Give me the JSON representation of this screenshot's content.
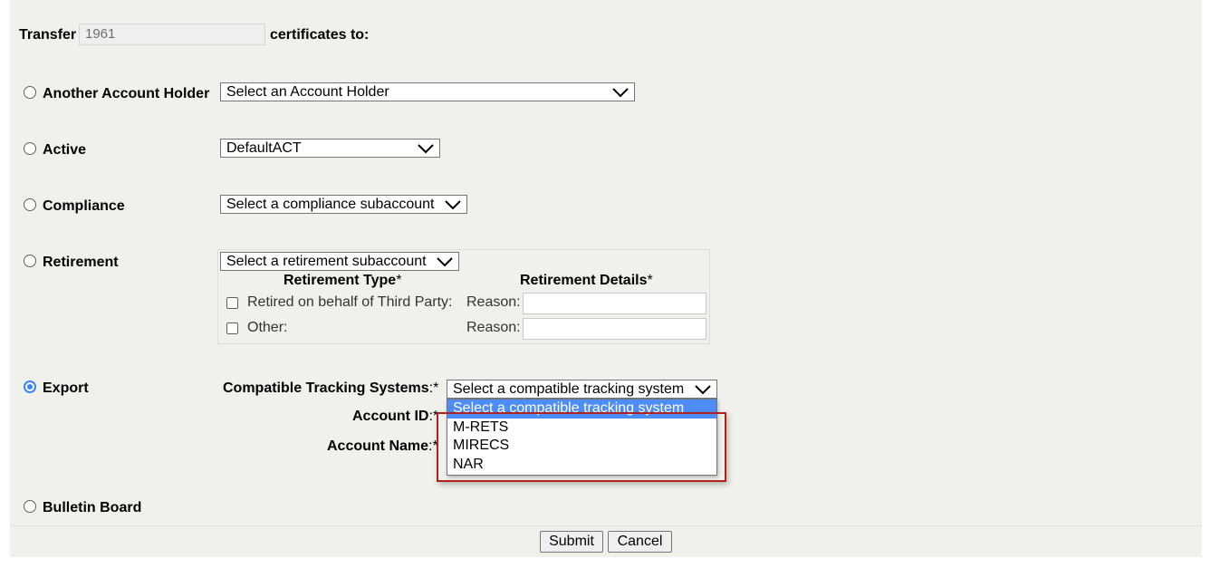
{
  "transfer": {
    "label": "Transfer",
    "quantity_value": "1961",
    "suffix": "certificates to:"
  },
  "destinations": {
    "another_account_holder": {
      "label": "Another Account Holder",
      "select_value": "Select an Account Holder",
      "checked": false
    },
    "active": {
      "label": "Active",
      "select_value": "DefaultACT",
      "checked": false
    },
    "compliance": {
      "label": "Compliance",
      "select_value": "Select a compliance subaccount",
      "checked": false
    },
    "retirement": {
      "label": "Retirement",
      "select_value": "Select a retirement subaccount",
      "checked": false,
      "type_header": "Retirement Type",
      "details_header": "Retirement Details",
      "required_mark": "*",
      "rows": [
        {
          "label": "Retired on behalf of Third Party:",
          "reason_label": "Reason:",
          "reason_value": ""
        },
        {
          "label": "Other:",
          "reason_label": "Reason:",
          "reason_value": ""
        }
      ]
    },
    "export": {
      "label": "Export",
      "checked": true,
      "tracking_label": "Compatible Tracking Systems",
      "tracking_value": "Select a compatible tracking system",
      "account_id_label": "Account ID",
      "account_name_label": "Account Name",
      "required_suffix": ":*",
      "dropdown_options": [
        "Select a compatible tracking system",
        "M-RETS",
        "MIRECS",
        "NAR"
      ]
    },
    "bulletin_board": {
      "label": "Bulletin Board",
      "checked": false
    }
  },
  "buttons": {
    "submit": "Submit",
    "cancel": "Cancel"
  },
  "colors": {
    "panel_bg": "#f1f1ec",
    "accent": "#3b82f6",
    "highlight_border": "#b22020",
    "selected_option_bg": "#4d8dfa"
  }
}
